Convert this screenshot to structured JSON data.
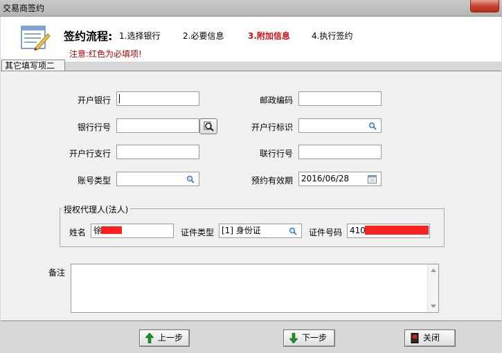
{
  "window": {
    "title": "交易商签约"
  },
  "header": {
    "flow_title": "签约流程:",
    "steps": [
      {
        "label": "1.选择银行",
        "active": false
      },
      {
        "label": "2.必要信息",
        "active": false
      },
      {
        "label": "3.附加信息",
        "active": true
      },
      {
        "label": "4.执行签约",
        "active": false
      }
    ],
    "note": "注意:红色为必填项!"
  },
  "tab": {
    "label": "其它填写项二"
  },
  "form": {
    "open_bank": {
      "label": "开户银行",
      "value": ""
    },
    "postcode": {
      "label": "邮政编码",
      "value": ""
    },
    "bank_code": {
      "label": "银行行号",
      "value": ""
    },
    "bank_flag": {
      "label": "开户行标识",
      "value": ""
    },
    "branch": {
      "label": "开户行支行",
      "value": ""
    },
    "union_code": {
      "label": "联行行号",
      "value": ""
    },
    "account_type": {
      "label": "账号类型",
      "value": ""
    },
    "valid_date": {
      "label": "预约有效期",
      "value": "2016/06/28"
    }
  },
  "agent": {
    "legend": "授权代理人(法人)",
    "name": {
      "label": "姓名",
      "value": "徐"
    },
    "id_type": {
      "label": "证件类型",
      "value": "[1] 身份证"
    },
    "id_number": {
      "label": "证件号码",
      "value": "4103"
    }
  },
  "memo": {
    "label": "备注",
    "value": ""
  },
  "buttons": {
    "prev": "上一步",
    "next": "下一步",
    "close": "关闭"
  },
  "colors": {
    "active_step": "#d01010",
    "note": "#b00000",
    "redaction": "#ff2020"
  }
}
